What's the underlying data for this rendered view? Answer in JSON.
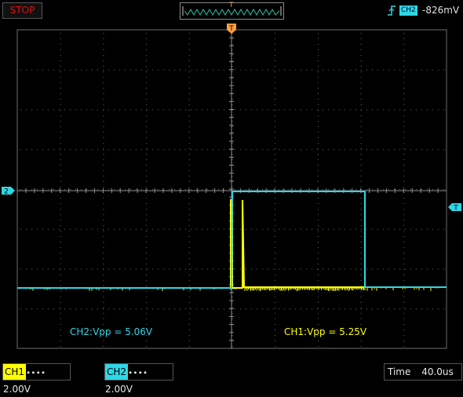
{
  "run_state": "STOP",
  "buffer_marker": "T",
  "trigger": {
    "source": "CH2",
    "level": "-826mV",
    "edge_icon": "rising-edge-icon"
  },
  "markers": {
    "ch2_marker": "2",
    "trigger_level_marker": "T",
    "trigger_pos_marker": "T"
  },
  "measurements": {
    "ch2": "CH2:Vpp = 5.06V",
    "ch1": "CH1:Vpp = 5.25V"
  },
  "channels": [
    {
      "name": "CH1",
      "coupling_icon": "dc-coupling-icon",
      "scale": "2.00V",
      "color": "#ffff00"
    },
    {
      "name": "CH2",
      "coupling_icon": "dc-coupling-icon",
      "scale": "2.00V",
      "color": "#2fd6e6"
    }
  ],
  "timebase": {
    "label": "Time",
    "value": "40.0us"
  },
  "colors": {
    "ch1": "#ffff00",
    "ch2": "#2fd6e6",
    "trigger_marker": "#ff9f40",
    "stop": "#e01010",
    "grid": "#707070"
  }
}
